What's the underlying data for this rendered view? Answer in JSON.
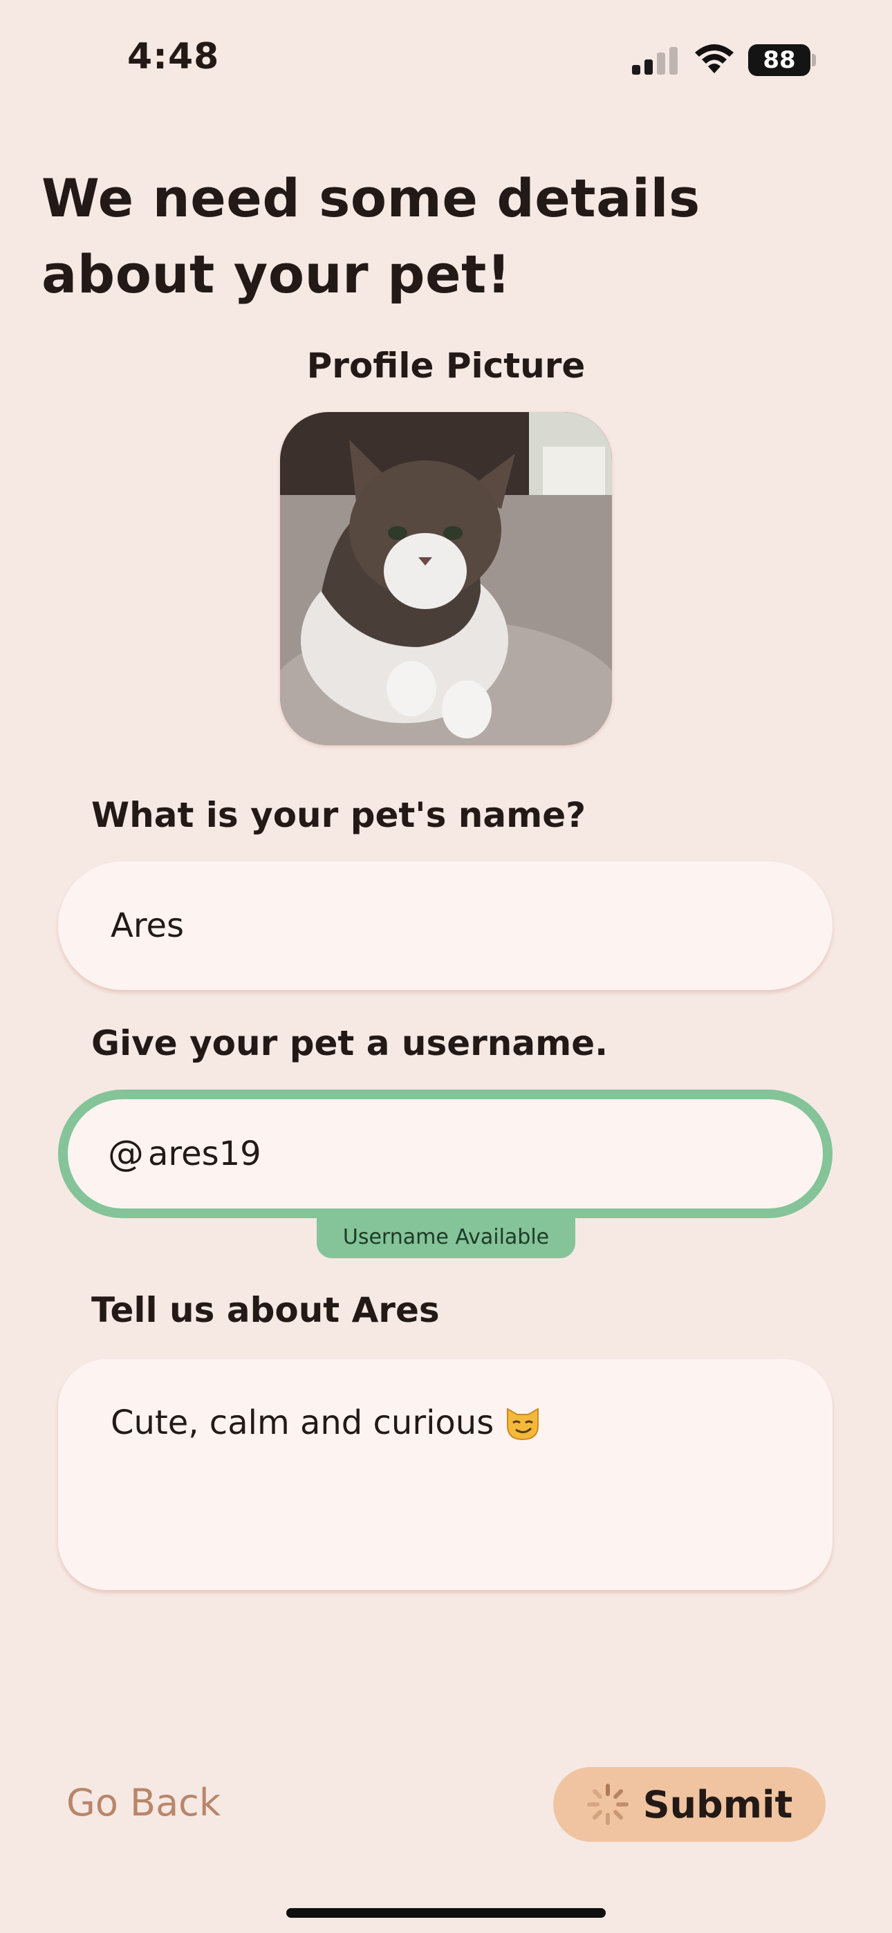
{
  "status_bar": {
    "time": "4:48",
    "battery_level": "88"
  },
  "page": {
    "title": "We need some details about your pet!"
  },
  "profile": {
    "label": "Profile Picture"
  },
  "name": {
    "label": "What is your pet's name?",
    "value": "Ares"
  },
  "username": {
    "label": "Give your pet a username.",
    "prefix": "@",
    "value": "ares19",
    "status": "Username Available"
  },
  "about": {
    "label": "Tell us about Ares",
    "value": "Cute, calm and curious"
  },
  "actions": {
    "back_label": "Go Back",
    "submit_label": "Submit"
  },
  "colors": {
    "background": "#f6e9e4",
    "success": "#84c498",
    "submit_bg": "#f0c4a0",
    "back_text": "#b9866a"
  }
}
